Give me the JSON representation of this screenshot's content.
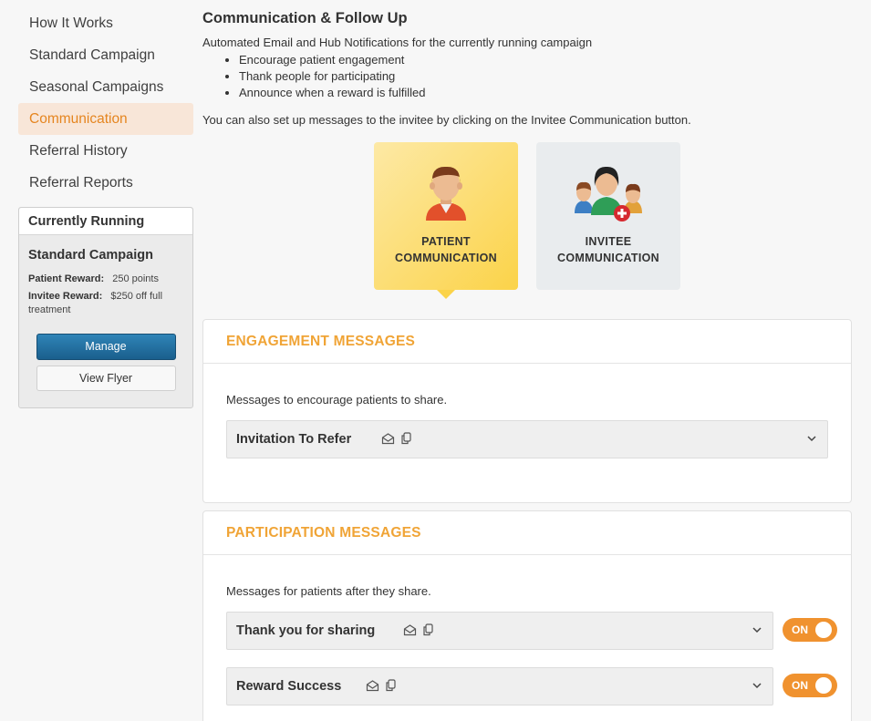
{
  "sidebar": {
    "items": [
      {
        "label": "How It Works"
      },
      {
        "label": "Standard Campaign"
      },
      {
        "label": "Seasonal Campaigns"
      },
      {
        "label": "Communication"
      },
      {
        "label": "Referral History"
      },
      {
        "label": "Referral Reports"
      }
    ],
    "active_index": 3,
    "running": {
      "header": "Currently Running",
      "campaign": "Standard Campaign",
      "patient_reward_label": "Patient Reward:",
      "patient_reward_value": "250 points",
      "invitee_reward_label": "Invitee Reward:",
      "invitee_reward_value": "$250 off full treatment",
      "manage_label": "Manage",
      "flyer_label": "View Flyer"
    }
  },
  "main": {
    "title": "Communication & Follow Up",
    "intro": "Automated Email and Hub Notifications for the currently running campaign",
    "bullets": [
      "Encourage patient engagement",
      "Thank people for participating",
      "Announce when a reward is fulfilled"
    ],
    "note": "You can also set up messages to the invitee by clicking on the Invitee Communication button.",
    "cards": {
      "patient_line1": "PATIENT",
      "patient_line2": "COMMUNICATION",
      "invitee_line1": "INVITEE",
      "invitee_line2": "COMMUNICATION"
    },
    "engagement": {
      "title": "ENGAGEMENT MESSAGES",
      "desc": "Messages to encourage patients to share.",
      "messages": [
        {
          "title": "Invitation To Refer"
        }
      ]
    },
    "participation": {
      "title": "PARTICIPATION MESSAGES",
      "desc": "Messages for patients after they share.",
      "messages": [
        {
          "title": "Thank you for sharing",
          "toggle": "ON"
        },
        {
          "title": "Reward Success",
          "toggle": "ON"
        }
      ]
    }
  },
  "colors": {
    "accent_orange": "#f0922f",
    "section_title": "#f0a436",
    "manage_blue": "#1a5f8d",
    "patient_card_yellow": "#fbd349"
  }
}
